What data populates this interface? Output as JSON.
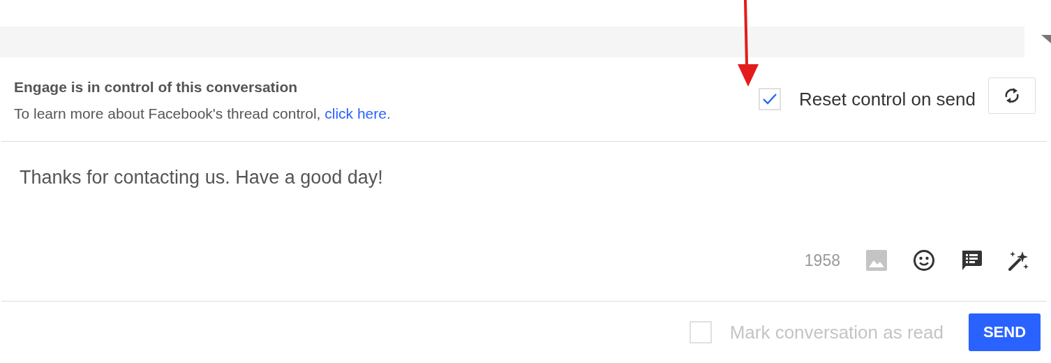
{
  "control_notice": {
    "title": "Engage is in control of this conversation",
    "text": "To learn more about Facebook's thread control, ",
    "link": "click here."
  },
  "reset_control": {
    "label": "Reset control on send",
    "checked": true
  },
  "message": {
    "value": "Thanks for contacting us. Have a good day!"
  },
  "char_count": "1958",
  "toolbar": [
    {
      "kind": "image",
      "disabled": true
    },
    {
      "kind": "emoji",
      "disabled": false
    },
    {
      "kind": "canned",
      "disabled": false
    },
    {
      "kind": "magic",
      "disabled": false
    }
  ],
  "mark_read": {
    "label": "Mark conversation as read",
    "checked": false,
    "disabled": true
  },
  "send_button": "SEND"
}
